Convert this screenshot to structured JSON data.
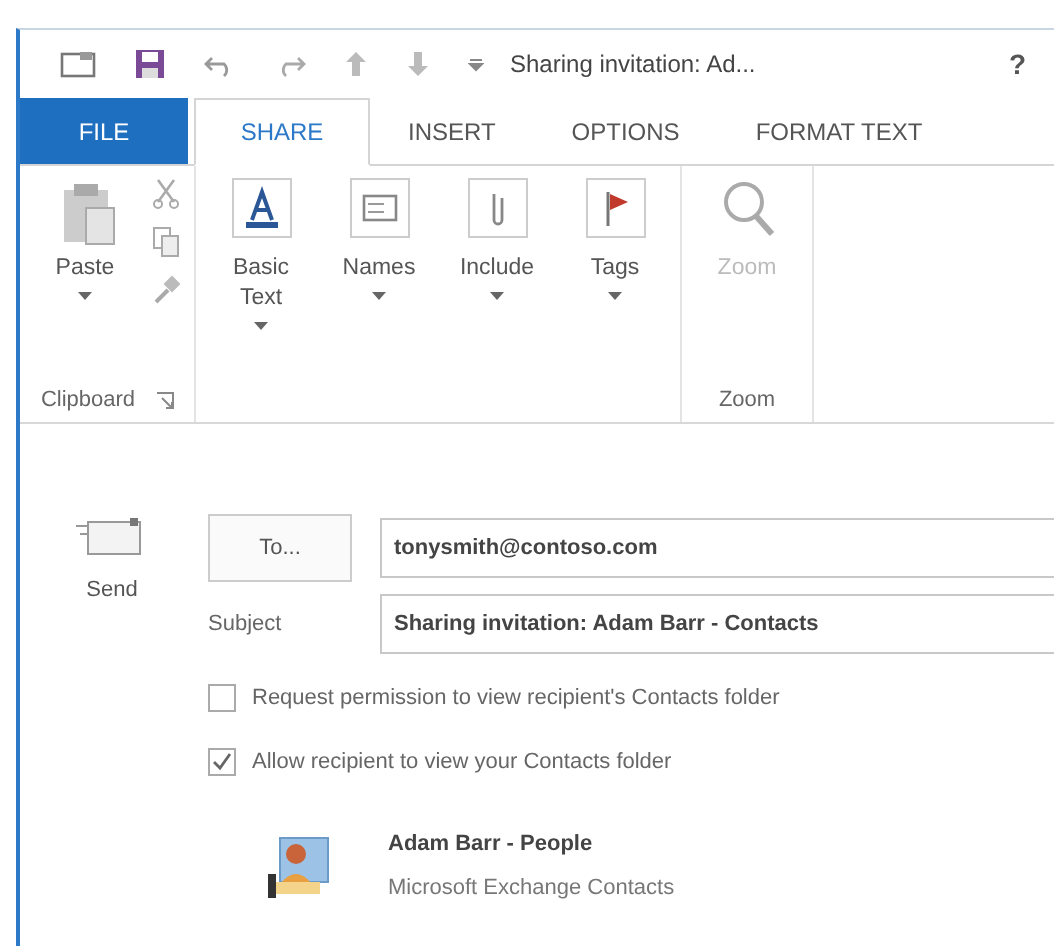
{
  "window": {
    "title": "Sharing invitation: Ad...",
    "help": "?"
  },
  "tabs": [
    {
      "label": "FILE",
      "kind": "file",
      "selected": false
    },
    {
      "label": "SHARE",
      "kind": "tab",
      "selected": true
    },
    {
      "label": "INSERT",
      "kind": "tab",
      "selected": false
    },
    {
      "label": "OPTIONS",
      "kind": "tab",
      "selected": false
    },
    {
      "label": "FORMAT TEXT",
      "kind": "tab",
      "selected": false
    }
  ],
  "ribbon": {
    "groups": [
      {
        "kind": "clipboard",
        "label": "Clipboard",
        "buttons": [
          {
            "label": "Paste",
            "dropdown": true,
            "kind": "paste",
            "disabled": false
          }
        ]
      },
      {
        "kind": "plain",
        "buttons": [
          {
            "label": "Basic Text",
            "dropdown": true,
            "kind": "text",
            "disabled": false
          },
          {
            "label": "Names",
            "dropdown": true,
            "kind": "names",
            "disabled": false
          },
          {
            "label": "Include",
            "dropdown": true,
            "kind": "include",
            "disabled": false
          },
          {
            "label": "Tags",
            "dropdown": true,
            "kind": "flag",
            "disabled": false
          }
        ]
      },
      {
        "kind": "plain",
        "label": "Zoom",
        "buttons": [
          {
            "label": "Zoom",
            "dropdown": false,
            "kind": "zoom",
            "disabled": true
          }
        ]
      }
    ]
  },
  "message": {
    "send": "Send",
    "to_button": "To...",
    "to": "tonysmith@contoso.com",
    "subject_label": "Subject",
    "subject": "Sharing invitation: Adam Barr - Contacts",
    "options": [
      {
        "label": "Request permission to view recipient's Contacts folder",
        "checked": false
      },
      {
        "label": "Allow recipient to view your Contacts folder",
        "checked": true
      }
    ],
    "attachment": {
      "title": "Adam Barr - People",
      "subtitle": "Microsoft Exchange Contacts"
    }
  }
}
